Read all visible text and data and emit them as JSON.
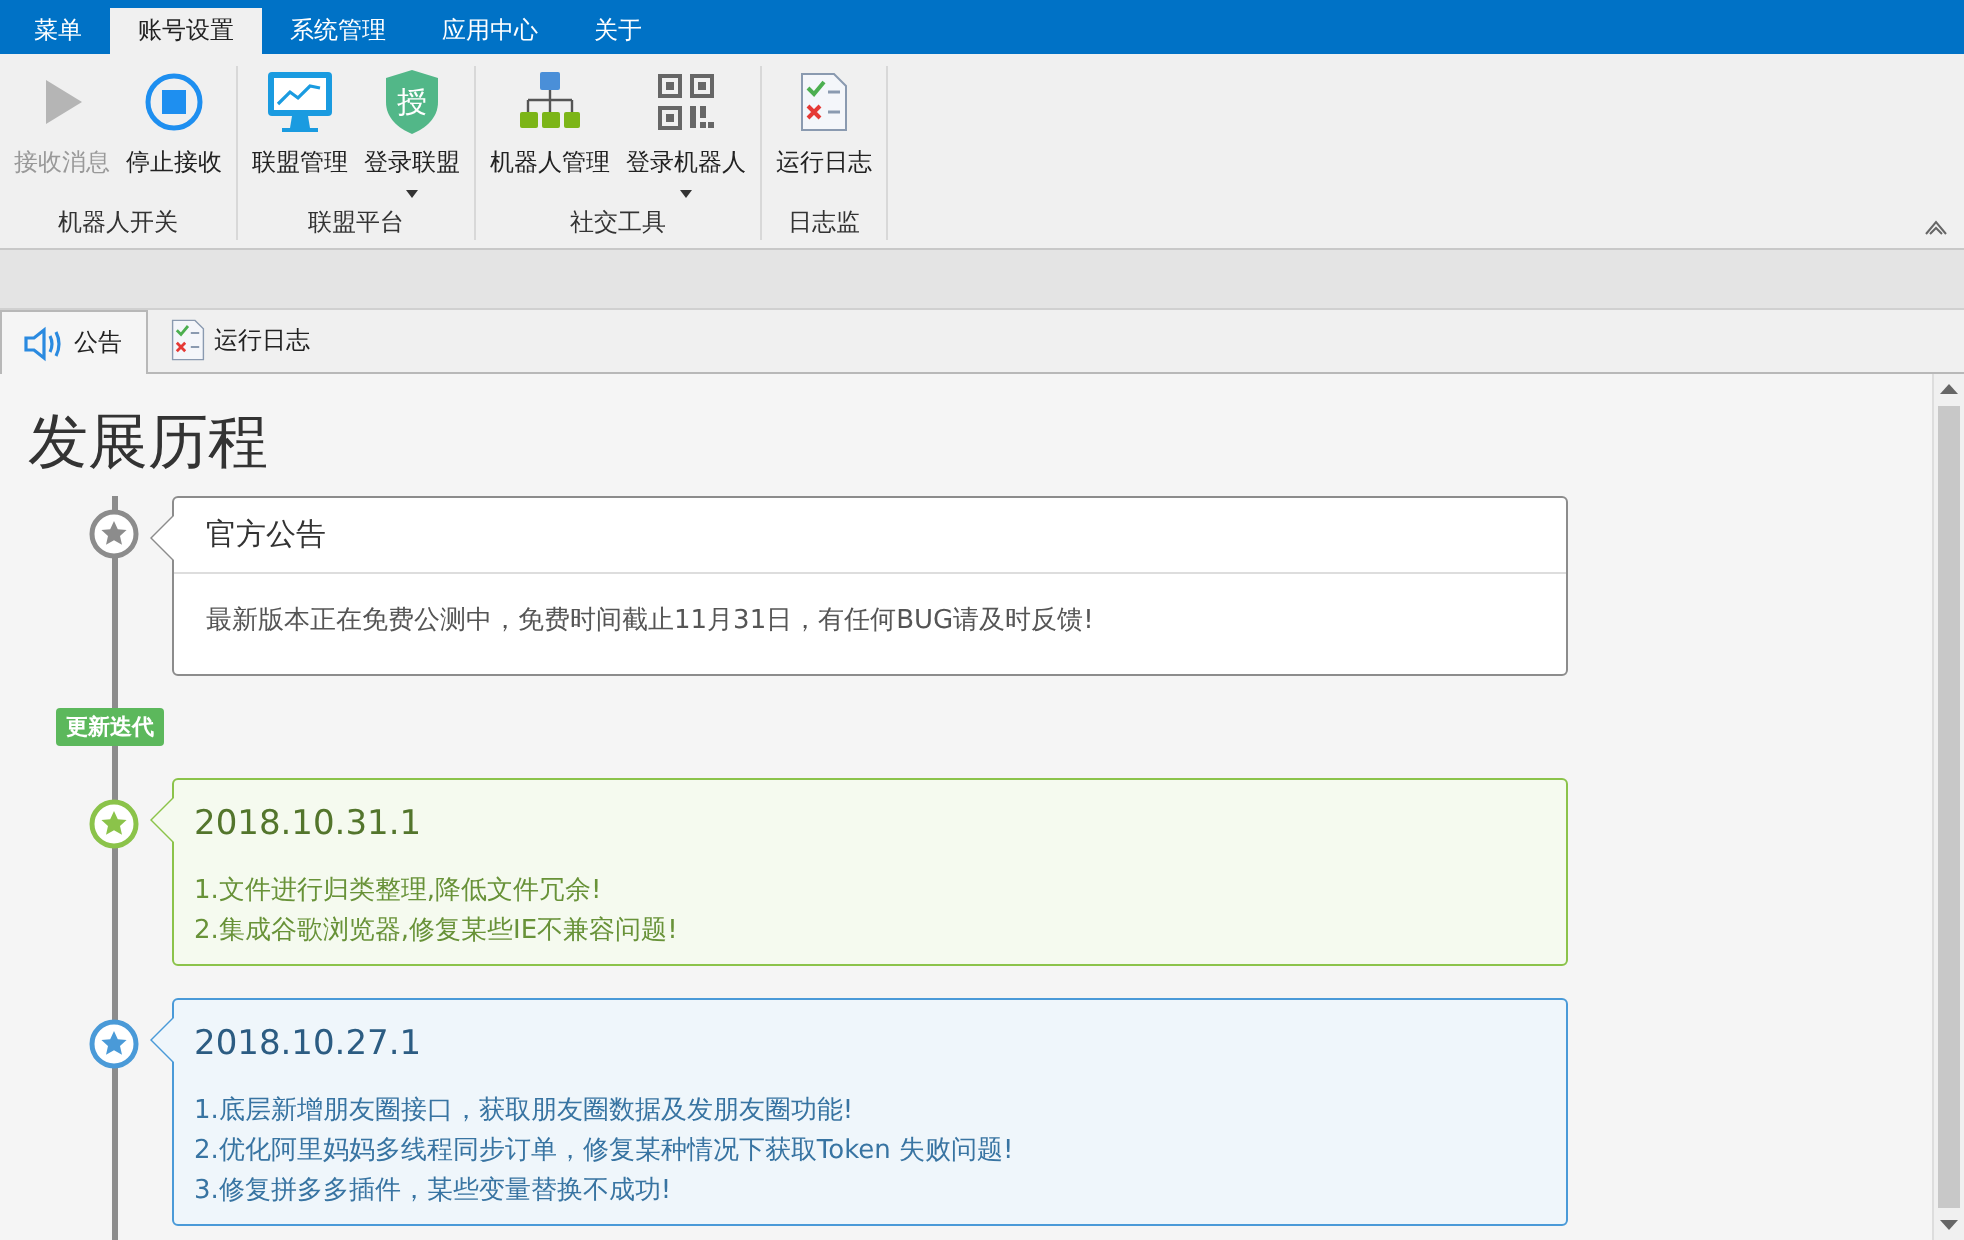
{
  "menu_tabs": [
    {
      "label": "菜单",
      "selected": false
    },
    {
      "label": "账号设置",
      "selected": true
    },
    {
      "label": "系统管理",
      "selected": false
    },
    {
      "label": "应用中心",
      "selected": false
    },
    {
      "label": "关于",
      "selected": false
    }
  ],
  "ribbon": {
    "groups": [
      {
        "label": "机器人开关",
        "buttons": [
          {
            "label": "接收消息",
            "disabled": true,
            "has_menu": false
          },
          {
            "label": "停止接收",
            "disabled": false,
            "has_menu": false
          }
        ]
      },
      {
        "label": "联盟平台",
        "buttons": [
          {
            "label": "联盟管理",
            "disabled": false,
            "has_menu": false
          },
          {
            "label": "登录联盟",
            "disabled": false,
            "has_menu": true,
            "icon_text": "授"
          }
        ]
      },
      {
        "label": "社交工具",
        "buttons": [
          {
            "label": "机器人管理",
            "disabled": false,
            "has_menu": false
          },
          {
            "label": "登录机器人",
            "disabled": false,
            "has_menu": true
          }
        ]
      },
      {
        "label": "日志监",
        "buttons": [
          {
            "label": "运行日志",
            "disabled": false,
            "has_menu": false
          }
        ]
      }
    ]
  },
  "doc_tabs": [
    {
      "label": "公告",
      "selected": true
    },
    {
      "label": "运行日志",
      "selected": false
    }
  ],
  "page": {
    "title": "发展历程",
    "timeline": [
      {
        "kind": "notice",
        "color": "#8c8c8c",
        "title": "官方公告",
        "lines": [
          "最新版本正在免费公测中，免费时间截止11月31日，有任何BUG请及时反馈!"
        ]
      },
      {
        "kind": "tag",
        "label": "更新迭代"
      },
      {
        "kind": "release",
        "color": "#8bc34a",
        "title": "2018.10.31.1",
        "lines": [
          "1.文件进行归类整理,降低文件冗余!",
          "2.集成谷歌浏览器,修复某些IE不兼容问题!"
        ]
      },
      {
        "kind": "release",
        "color": "#4a9ad8",
        "title": "2018.10.27.1",
        "lines": [
          "1.底层新增朋友圈接口，获取朋友圈数据及发朋友圈功能!",
          "2.优化阿里妈妈多线程同步订单，修复某种情况下获取Token 失败问题!",
          "3.修复拼多多插件，某些变量替换不成功!"
        ]
      }
    ]
  }
}
